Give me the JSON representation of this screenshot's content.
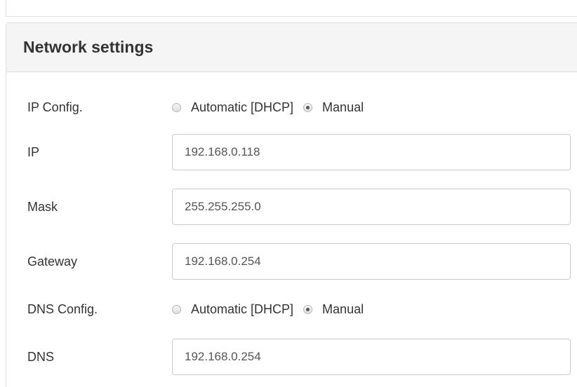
{
  "panel": {
    "title": "Network settings"
  },
  "ip_config": {
    "label": "IP Config.",
    "options": [
      "Automatic [DHCP]",
      "Manual"
    ],
    "selected": "Manual"
  },
  "ip": {
    "label": "IP",
    "value": "192.168.0.118"
  },
  "mask": {
    "label": "Mask",
    "value": "255.255.255.0"
  },
  "gateway": {
    "label": "Gateway",
    "value": "192.168.0.254"
  },
  "dns_config": {
    "label": "DNS Config.",
    "options": [
      "Automatic [DHCP]",
      "Manual"
    ],
    "selected": "Manual"
  },
  "dns": {
    "label": "DNS",
    "value": "192.168.0.254"
  }
}
